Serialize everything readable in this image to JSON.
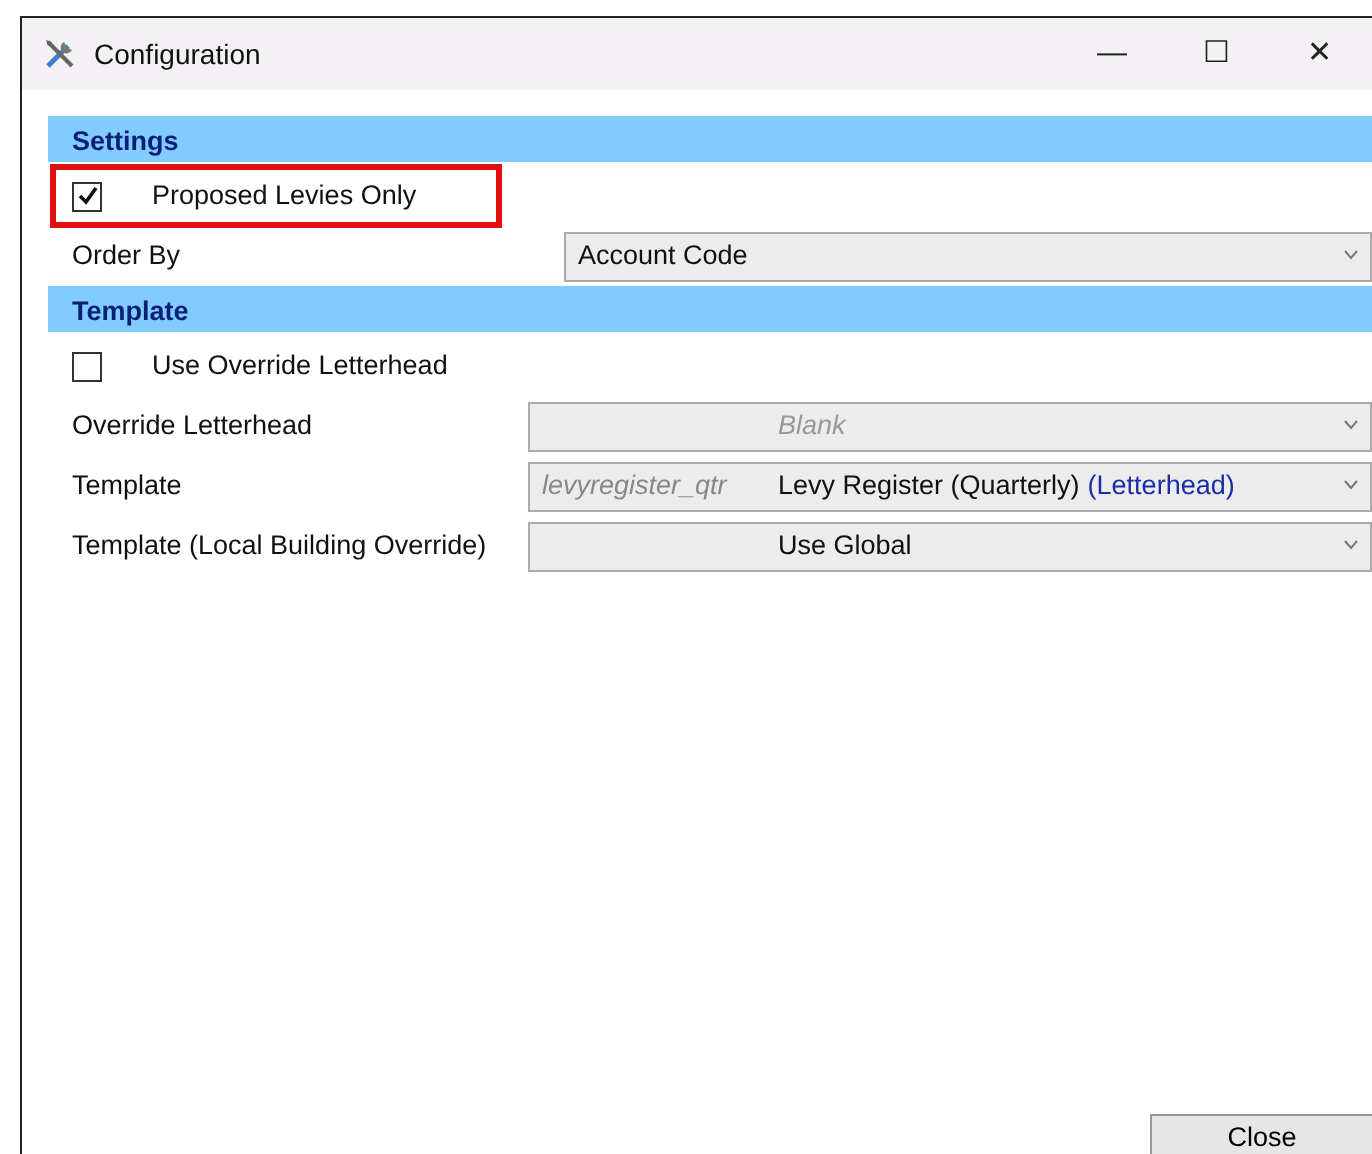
{
  "window": {
    "title": "Configuration",
    "controls": [
      "—",
      "☐",
      "✕"
    ]
  },
  "sections": [
    {
      "title": "Settings",
      "rows": [
        {
          "kind": "checkbox",
          "label": "Proposed Levies Only",
          "checked": true,
          "highlighted": true
        },
        {
          "kind": "combo",
          "label": "Order By",
          "value": "Account Code",
          "disabled": false
        }
      ]
    },
    {
      "title": "Template",
      "rows": [
        {
          "kind": "checkbox",
          "label": "Use Override Letterhead",
          "checked": false,
          "highlighted": false
        },
        {
          "kind": "coded-combo",
          "label": "Override Letterhead",
          "value": "Blank",
          "disabled": true
        },
        {
          "kind": "coded-combo",
          "label": "Template",
          "code": "levyregister_qtr",
          "value": "Levy Register (Quarterly)",
          "tag": "(Letterhead)",
          "disabled": false
        },
        {
          "kind": "coded-combo",
          "label": "Template (Local Building Override)",
          "value": "Use Global",
          "disabled": false
        }
      ]
    }
  ],
  "buttons": [
    "Close"
  ]
}
